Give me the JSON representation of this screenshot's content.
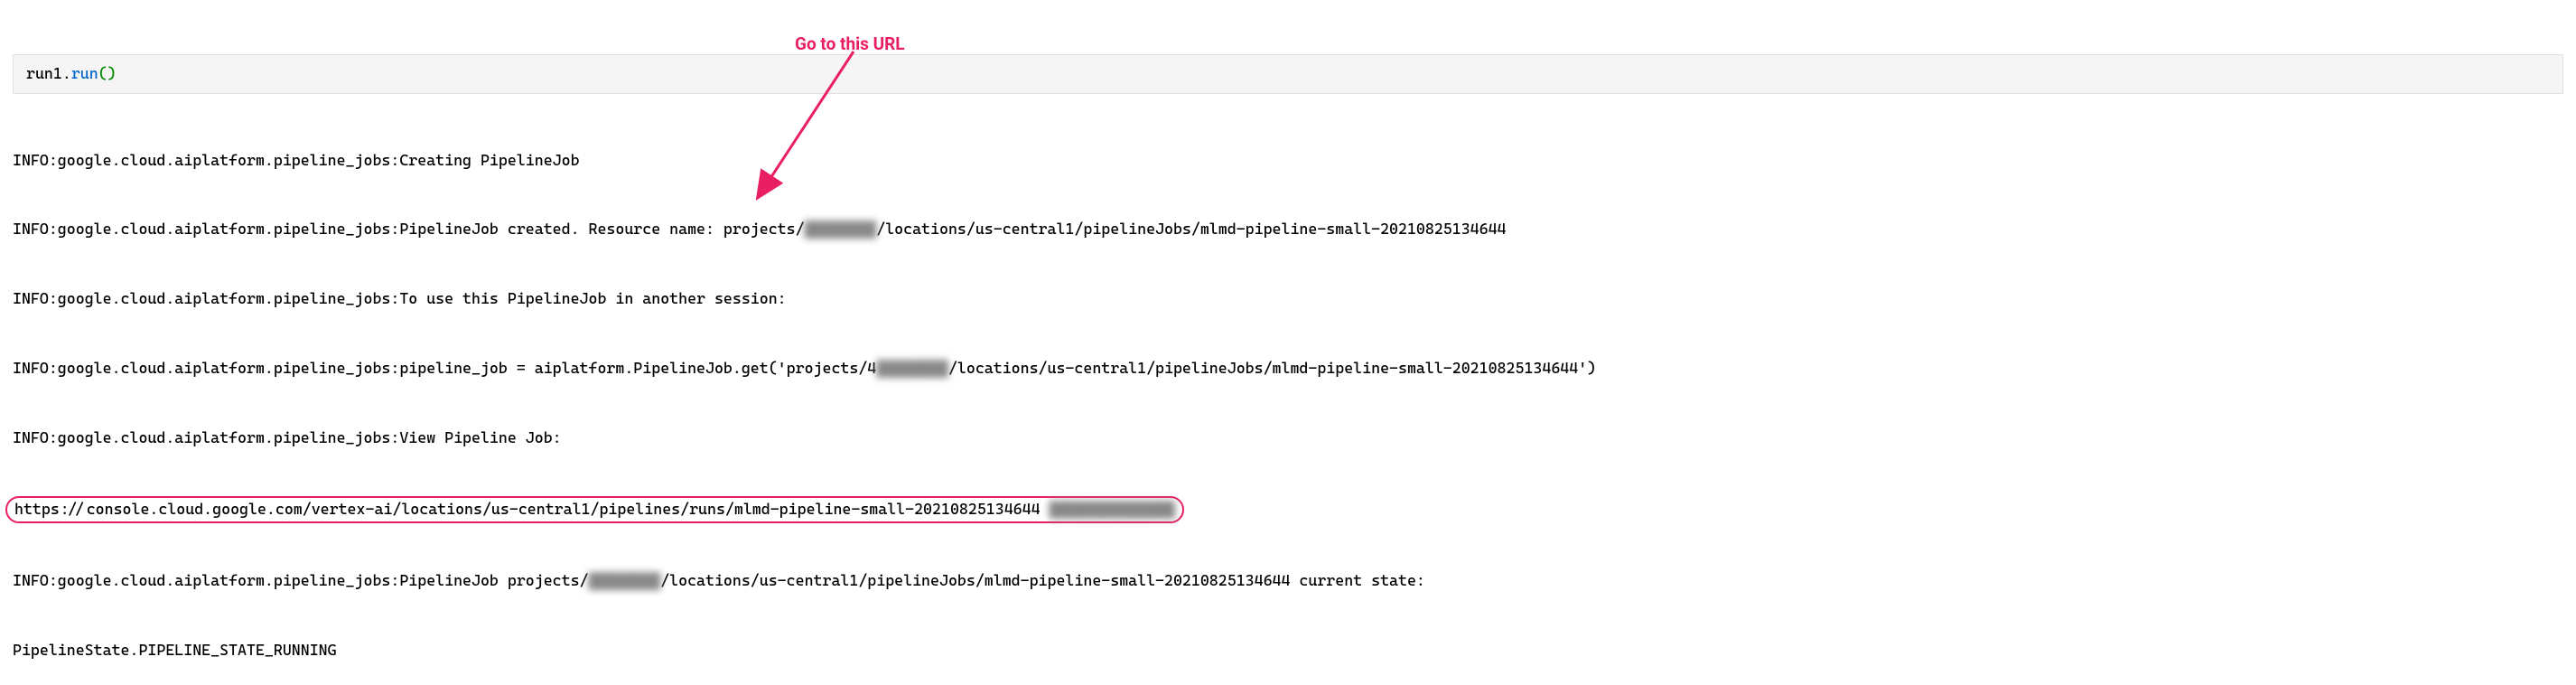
{
  "annotation": {
    "text": "Go to this URL"
  },
  "code": {
    "obj": "run1.",
    "method": "run",
    "parens": "()"
  },
  "output": {
    "line1_prefix": "INFO:google.cloud.aiplatform.pipeline_jobs:Creating PipelineJob",
    "line2_prefix": "INFO:google.cloud.aiplatform.pipeline_jobs:PipelineJob created. Resource name: projects/",
    "line2_blur": "████████",
    "line2_suffix": "/locations/us-central1/pipelineJobs/mlmd-pipeline-small-20210825134644",
    "line3": "INFO:google.cloud.aiplatform.pipeline_jobs:To use this PipelineJob in another session:",
    "line4_prefix": "INFO:google.cloud.aiplatform.pipeline_jobs:pipeline_job = aiplatform.PipelineJob.get('projects/4",
    "line4_blur": "████████",
    "line4_suffix": "/locations/us-central1/pipelineJobs/mlmd-pipeline-small-20210825134644')",
    "line5": "INFO:google.cloud.aiplatform.pipeline_jobs:View Pipeline Job:",
    "line6_url": "https://console.cloud.google.com/vertex-ai/locations/us-central1/pipelines/runs/mlmd-pipeline-small-20210825134644",
    "line6_blur": "██████████████",
    "line7_prefix": "INFO:google.cloud.aiplatform.pipeline_jobs:PipelineJob projects/",
    "line7_blur": "████████",
    "line7_suffix": "/locations/us-central1/pipelineJobs/mlmd-pipeline-small-20210825134644 current state:",
    "line8": "PipelineState.PIPELINE_STATE_RUNNING"
  }
}
